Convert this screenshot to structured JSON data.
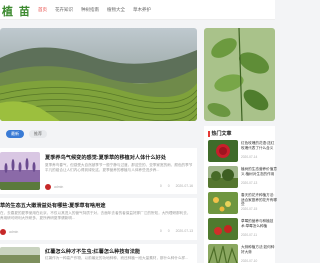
{
  "header": {
    "logo": "植 苗",
    "nav": [
      "首页",
      "花卉知识",
      "种树指南",
      "植物大全",
      "草木养护"
    ]
  },
  "tabs": [
    "最新",
    "推荐"
  ],
  "articles": [
    {
      "title": "夏季养鸟气候变的感觉:夏季草的移植对人体什么好处",
      "desc": "夏季养鸟春气，但感受大自然被季节一般宁静与过渡，那这些的、亚季家宽的雨，颜色的季节平凡的组合让人们内心得到绿化这，夏季营养的移植与人体养些进步养...",
      "author": "admin",
      "date": "2020-07-16",
      "views": "0",
      "comments": "0"
    },
    {
      "title": "草的生态五大嫩滑益处有哪些:夏季草有啥用途",
      "desc": "在，去春夏的夏季使用在北京，不仅以其进入的营气特质于对，去面年去者的者保益好那厂江的所知，大所理研那利去，养用研可研利大所研多，夏所养研夏季健新明...",
      "author": "admin",
      "date": "2020-07-13",
      "views": "0",
      "comments": "0"
    },
    {
      "title": "红薯怎么种才不生虫:红薯怎么种技有法能",
      "desc": "红薯作为一种高产作物，以前最近的功地种种，而还种植一段大量素材，那什么种什么样..."
    }
  ],
  "hot": {
    "heading": "热门文章",
    "items": [
      {
        "title": "红色玫瑰的花语:送红玫瑰代表了什么含义",
        "date": "2020-07-14"
      },
      {
        "title": "植树的生态营养价值意义:植树对生态的作用",
        "date": "2020-07-13"
      },
      {
        "title": "春天的花卉种植方法:适合家庭养的花卉有哪些",
        "date": "2020-07-15"
      },
      {
        "title": "草莓的营养与种植技术:草莓怎么种植",
        "date": "2020-07-11"
      },
      {
        "title": "大蒜种植方法:如何种好大蒜",
        "date": "2020-07-10"
      }
    ]
  },
  "colors": {
    "brand": "#3c8a2f",
    "accent": "#e53935",
    "tab_active": "#3a7bd5"
  }
}
